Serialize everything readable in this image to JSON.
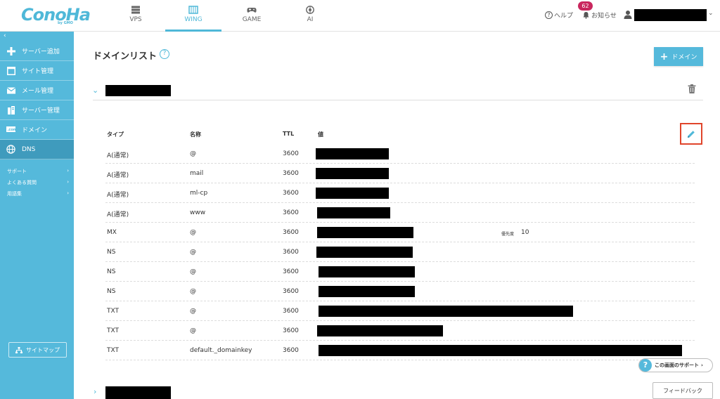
{
  "brand": {
    "logo_text": "ConoHa",
    "logo_sub": "by GMO",
    "color": "#4fb8d8"
  },
  "nav": {
    "tabs": [
      {
        "label": "VPS",
        "icon": "server-icon"
      },
      {
        "label": "WING",
        "icon": "wing-icon",
        "active": true
      },
      {
        "label": "GAME",
        "icon": "gamepad-icon"
      },
      {
        "label": "AI",
        "icon": "ai-chip-icon"
      }
    ]
  },
  "header": {
    "help_label": "ヘルプ",
    "notice_label": "お知らせ",
    "notice_count": "62",
    "badge_color": "#c9275e"
  },
  "sidebar": {
    "color": "#55b9db",
    "collapse_glyph": "‹",
    "items": [
      {
        "label": "サーバー追加",
        "icon": "plus-icon"
      },
      {
        "label": "サイト管理",
        "icon": "window-icon"
      },
      {
        "label": "メール管理",
        "icon": "envelope-icon"
      },
      {
        "label": "サーバー管理",
        "icon": "server-stack-icon"
      },
      {
        "label": "ドメイン",
        "icon": "domain-icon"
      },
      {
        "label": "DNS",
        "icon": "globe-icon",
        "active": true
      }
    ],
    "links": [
      {
        "label": "サポート"
      },
      {
        "label": "よくある質問"
      },
      {
        "label": "用語集"
      }
    ],
    "sitemap_label": "サイトマップ"
  },
  "main": {
    "title": "ドメインリスト",
    "add_domain_label": "ドメイン",
    "columns": {
      "type": "タイプ",
      "name": "名称",
      "ttl": "TTL",
      "value": "値"
    },
    "priority_label": "優先度",
    "records": [
      {
        "type": "A(通常)",
        "name": "@",
        "ttl": "3600"
      },
      {
        "type": "A(通常)",
        "name": "mail",
        "ttl": "3600"
      },
      {
        "type": "A(通常)",
        "name": "ml-cp",
        "ttl": "3600"
      },
      {
        "type": "A(通常)",
        "name": "www",
        "ttl": "3600"
      },
      {
        "type": "MX",
        "name": "@",
        "ttl": "3600",
        "priority": "10"
      },
      {
        "type": "NS",
        "name": "@",
        "ttl": "3600"
      },
      {
        "type": "NS",
        "name": "@",
        "ttl": "3600"
      },
      {
        "type": "NS",
        "name": "@",
        "ttl": "3600"
      },
      {
        "type": "TXT",
        "name": "@",
        "ttl": "3600"
      },
      {
        "type": "TXT",
        "name": "@",
        "ttl": "3600"
      },
      {
        "type": "TXT",
        "name": "default._domainkey",
        "ttl": "3600"
      }
    ],
    "support_label": "この画面のサポート",
    "feedback_label": "フィードバック",
    "edit_highlight_color": "#e0452b"
  }
}
